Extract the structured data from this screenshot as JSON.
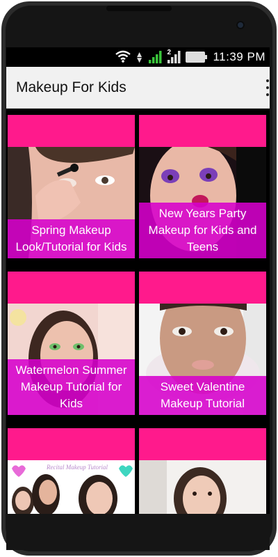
{
  "status_bar": {
    "time": "11:39 PM",
    "signal_sim_label": "2",
    "icons": [
      "wifi-icon",
      "data-arrows-icon",
      "signal-icon",
      "signal-icon-sim2",
      "battery-icon"
    ]
  },
  "app_bar": {
    "title": "Makeup For Kids",
    "overflow_icon": "overflow-menu-icon"
  },
  "colors": {
    "card_pink": "#ff1a8c",
    "caption_purple": "#d600cc",
    "app_bar_bg": "#f1f1f1"
  },
  "videos": [
    {
      "title": "Spring Makeup Look/Tutorial for Kids"
    },
    {
      "title": "New Years Party Makeup for Kids and Teens"
    },
    {
      "title": "Watermelon Summer Makeup Tutorial for Kids"
    },
    {
      "title": "Sweet Valentine Makeup Tutorial"
    },
    {
      "title": "",
      "thumbnail_text": "Recital Makeup Tutorial"
    },
    {
      "title": ""
    }
  ]
}
